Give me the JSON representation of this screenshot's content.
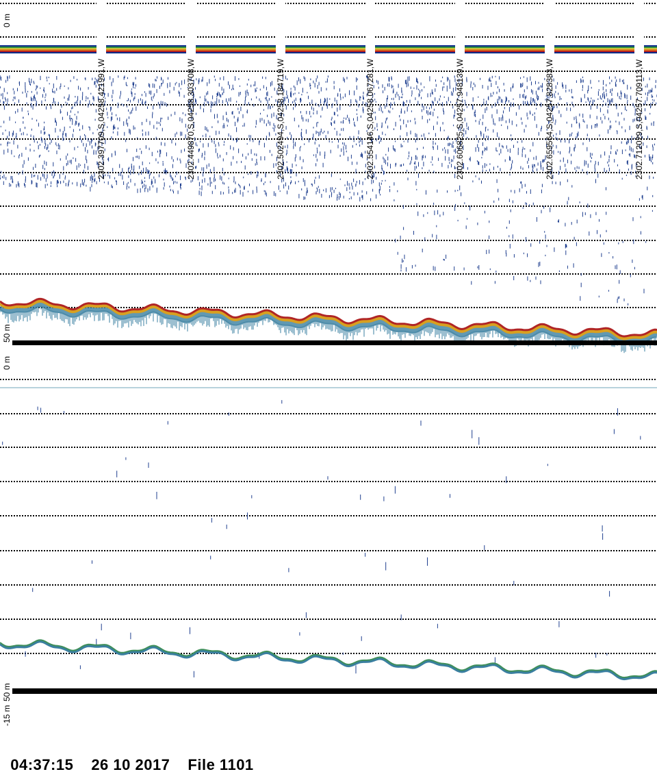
{
  "upper_panel": {
    "depth_top_label": "0  m",
    "depth_bottom_label": "50  m",
    "position_labels": [
      "2302.397709,S,04258.421991,W",
      "2302.449870,S,04258.303708,W",
      "2302.502494,S,04258.184719,W",
      "2302.554146,S,04258.067281,W",
      "2302.606825,S,04257.948139,W",
      "2302.659564,S,04257.828383,W",
      "2302.712029,S,04257.709113,W"
    ]
  },
  "lower_panel": {
    "depth_top_label": "0  m",
    "depth_bottom_label": "50  m",
    "depth_offset_label": "-15  m"
  },
  "footer": {
    "time": "04:37:15",
    "date": "26 10 2017",
    "file": "File 1101"
  },
  "colors": {
    "surface_band": [
      "#0a2a8a",
      "#2f8f3f",
      "#c9c23a",
      "#e07a1a",
      "#b52020"
    ],
    "plankton": "#1f3f8f",
    "bottom_strong": "#b02525",
    "bottom_mid": "#d8a020",
    "bottom_weak": "#3a7fa0",
    "baseline": "#000000"
  }
}
